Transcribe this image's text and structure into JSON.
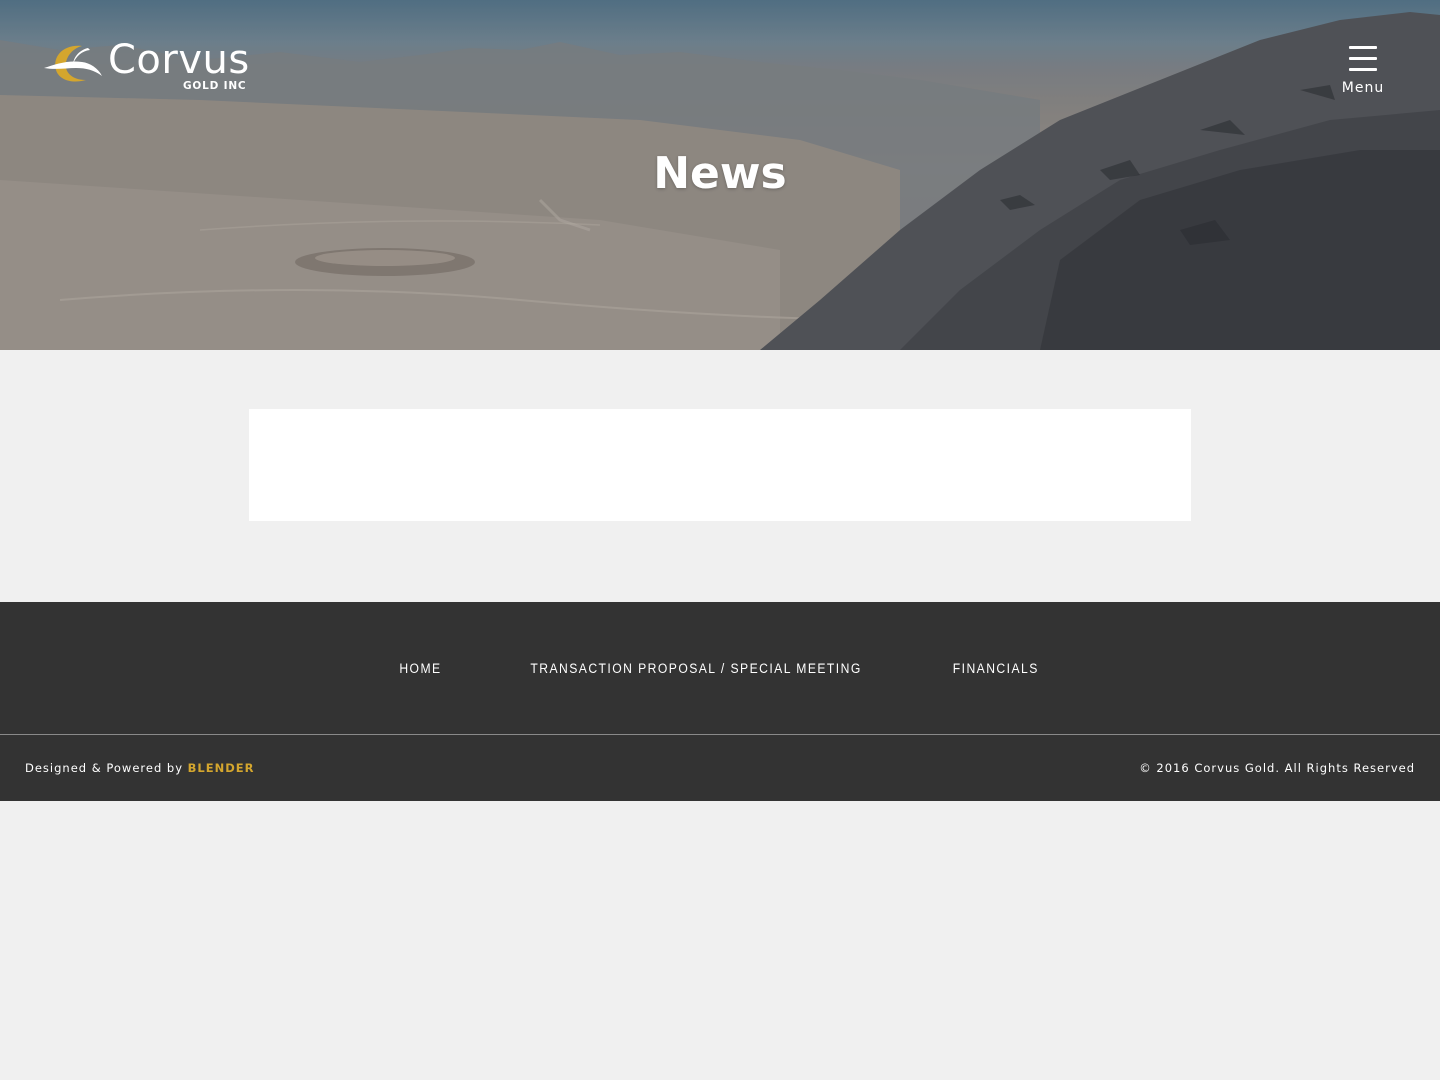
{
  "colors": {
    "accent_gold": "#d4a62e",
    "footer_bg": "#333333",
    "page_bg": "#f0f0f0",
    "card_bg": "#ffffff"
  },
  "header": {
    "logo": {
      "name": "Corvus",
      "subtitle": "GOLD INC",
      "icon": "crescent-bird-logo"
    },
    "menu": {
      "icon": "hamburger-icon",
      "label": "Menu"
    }
  },
  "hero": {
    "title": "News"
  },
  "footer": {
    "nav": [
      {
        "label": "HOME"
      },
      {
        "label": "TRANSACTION PROPOSAL / SPECIAL MEETING"
      },
      {
        "label": "FINANCIALS"
      }
    ],
    "credit_prefix": "Designed & Powered by",
    "credit_brand": "BLENDER",
    "copyright": "© 2016 Corvus Gold. All Rights Reserved"
  }
}
